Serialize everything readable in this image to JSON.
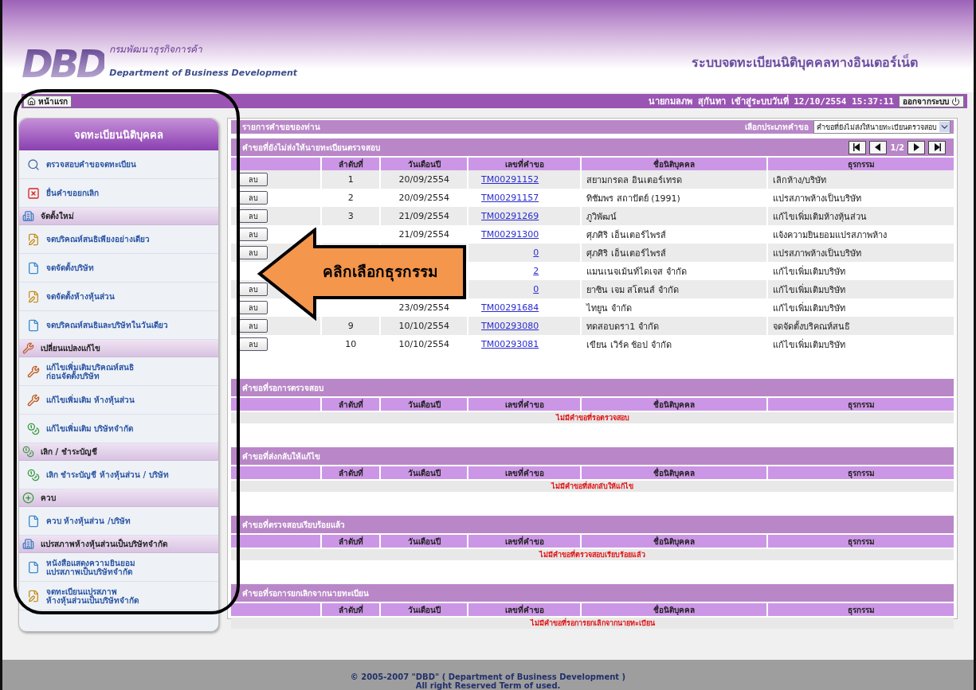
{
  "header": {
    "logo": "DBD",
    "org_thai": "กรมพัฒนาธุรกิจการค้า",
    "org_english": "Department of Business Development",
    "system_title": "ระบบจดทะเบียนนิติบุคคลทางอินเตอร์เน็ต"
  },
  "navbar": {
    "home": "หน้าแรก",
    "user": "นายกมลภพ  สุกันทา  เข้าสู่ระบบวันที่ 12/10/2554 15:37:11",
    "logout": "ออกจากระบบ"
  },
  "sidebar": {
    "title": "จดทะเบียนนิติบุคคล",
    "items": [
      {
        "kind": "item",
        "lines": [
          "ตรวจสอบคำขอจดทะเบียน"
        ]
      },
      {
        "kind": "item",
        "lines": [
          "ยื่นคำขอยกเลิก"
        ]
      },
      {
        "kind": "group",
        "lines": [
          "จัดตั้งใหม่"
        ]
      },
      {
        "kind": "item",
        "lines": [
          "จดบริคณห์สนธิเพียงอย่างเดียว"
        ]
      },
      {
        "kind": "item",
        "lines": [
          "จดจัดตั้งบริษัท"
        ]
      },
      {
        "kind": "item",
        "lines": [
          "จดจัดตั้งห้างหุ้นส่วน"
        ]
      },
      {
        "kind": "item",
        "lines": [
          "จดบริคณห์สนธิและบริษัทในวันเดียว"
        ]
      },
      {
        "kind": "group",
        "lines": [
          "เปลี่ยนแปลงแก้ไข"
        ]
      },
      {
        "kind": "item",
        "lines": [
          "แก้ไขเพิ่มเติมบริคณห์สนธิ",
          "ก่อนจัดตั้งบริษัท"
        ]
      },
      {
        "kind": "item",
        "lines": [
          "แก้ไขเพิ่มเติม ห้างหุ้นส่วน"
        ]
      },
      {
        "kind": "item",
        "lines": [
          "แก้ไขเพิ่มเติม บริษัทจำกัด"
        ]
      },
      {
        "kind": "group",
        "lines": [
          "เลิก / ชำระบัญชี"
        ]
      },
      {
        "kind": "item",
        "lines": [
          "เลิก ชำระบัญชี ห้างหุ้นส่วน / บริษัท"
        ]
      },
      {
        "kind": "group",
        "lines": [
          "ควบ"
        ]
      },
      {
        "kind": "item",
        "lines": [
          "ควบ ห้างหุ้นส่วน /บริษัท"
        ]
      },
      {
        "kind": "group",
        "lines": [
          "แปรสภาพห้างหุ้นส่วนเป็นบริษัทจำกัด"
        ]
      },
      {
        "kind": "item",
        "lines": [
          "หนังสือแสดงความยินยอม",
          "แปรสภาพเป็นบริษัทจำกัด"
        ]
      },
      {
        "kind": "item",
        "lines": [
          "จดทะเบียนแปรสภาพ",
          "ห้างหุ้นส่วนเป็นบริษัทจำกัด"
        ]
      }
    ]
  },
  "main": {
    "title": "รายการคำขอของท่าน",
    "filter_label": "เลือกประเภทคำขอ",
    "filter_value": "คำขอที่ยังไม่ส่งให้นายทะเบียนตรวจสอบ",
    "sections": [
      {
        "title": "คำขอที่ยังไม่ส่งให้นายทะเบียนตรวจสอบ",
        "page": "1/2",
        "columns": [
          "ลำดับที่",
          "วันเดือนปี",
          "เลขที่คำขอ",
          "ชื่อนิติบุคคล",
          "ธุรกรรม"
        ],
        "rows": [
          {
            "delete": "ลบ",
            "no": "1",
            "date": "20/09/2554",
            "request": "TM00291152",
            "name": "สยามกรดล อินเตอร์เทรด",
            "transaction": "เลิกห้าง/บริษัท"
          },
          {
            "delete": "ลบ",
            "no": "2",
            "date": "20/09/2554",
            "request": "TM00291157",
            "name": "ทิชัมพร สถาปัตย์ (1991)",
            "transaction": "แปรสภาพห้างเป็นบริษัท"
          },
          {
            "delete": "ลบ",
            "no": "3",
            "date": "21/09/2554",
            "request": "TM00291269",
            "name": "ภูวิพัฒน์",
            "transaction": "แก้ไขเพิ่มเติมห้างหุ้นส่วน"
          },
          {
            "delete": "ลบ",
            "date": "21/09/2554",
            "request": "TM00291300",
            "name": "ศุภศิริ เอ็นเตอร์ไพรส์",
            "transaction": "แจ้งความยินยอมแปรสภาพห้าง"
          },
          {
            "delete": "ลบ",
            "request": "0",
            "name": "ศุภศิริ เอ็นเตอร์ไพรส์",
            "transaction": "แปรสภาพห้างเป็นบริษัท"
          },
          {
            "request": "2",
            "name": "แมนเนจเม้นท์ไดเจส จำกัด",
            "transaction": "แก้ไขเพิ่มเติมบริษัท"
          },
          {
            "delete": "ลบ",
            "request": "0",
            "name": "ยาซิน เจม สโตนส์ จำกัด",
            "transaction": "แก้ไขเพิ่มเติมบริษัท"
          },
          {
            "delete": "ลบ",
            "date": "23/09/2554",
            "request": "TM00291684",
            "name": "ไทยูน จำกัด",
            "transaction": "แก้ไขเพิ่มเติมบริษัท"
          },
          {
            "delete": "ลบ",
            "no": "9",
            "date": "10/10/2554",
            "request": "TM00293080",
            "name": "ทดสอบดรา1 จำกัด",
            "transaction": "จดจัดตั้งบริคณห์สนธิ"
          },
          {
            "delete": "ลบ",
            "no": "10",
            "date": "10/10/2554",
            "request": "TM00293081",
            "name": "เขียน เวิร์ค ช้อป จำกัด",
            "transaction": "แก้ไขเพิ่มเติมบริษัท"
          }
        ]
      },
      {
        "title": "คำขอที่รอการตรวจสอบ",
        "columns": [
          "ลำดับที่",
          "วันเดือนปี",
          "เลขที่คำขอ",
          "ชื่อนิติบุคคล",
          "ธุรกรรม"
        ],
        "empty": "ไม่มีคำขอที่รอตรวจสอบ"
      },
      {
        "title": "คำขอที่ส่งกลับให้แก้ไข",
        "columns": [
          "ลำดับที่",
          "วันเดือนปี",
          "เลขที่คำขอ",
          "ชื่อนิติบุคคล",
          "ธุรกรรม"
        ],
        "empty": "ไม่มีคำขอที่ส่งกลับให้แก้ไข"
      },
      {
        "title": "คำขอที่ตรวจสอบเรียบร้อยแล้ว",
        "columns": [
          "ลำดับที่",
          "วันเดือนปี",
          "เลขที่คำขอ",
          "ชื่อนิติบุคคล",
          "ธุรกรรม"
        ],
        "empty": "ไม่มีคำขอที่ตรวจสอบเรียบร้อยแล้ว"
      },
      {
        "title": "คำขอที่รอการยกเลิกจากนายทะเบียน",
        "columns": [
          "ลำดับที่",
          "วันเดือนปี",
          "เลขที่คำขอ",
          "ชื่อนิติบุคคล",
          "ธุรกรรม"
        ],
        "empty": "ไม่มีคำขอที่รอการยกเลิกจากนายทะเบียน"
      }
    ]
  },
  "callout": {
    "text": "คลิกเลือกธุรกรรม"
  },
  "footer": {
    "copyright": "© 2005-2007 \"DBD\" ( Department of Business Development )",
    "rights": "All right Reserved Term of used."
  }
}
